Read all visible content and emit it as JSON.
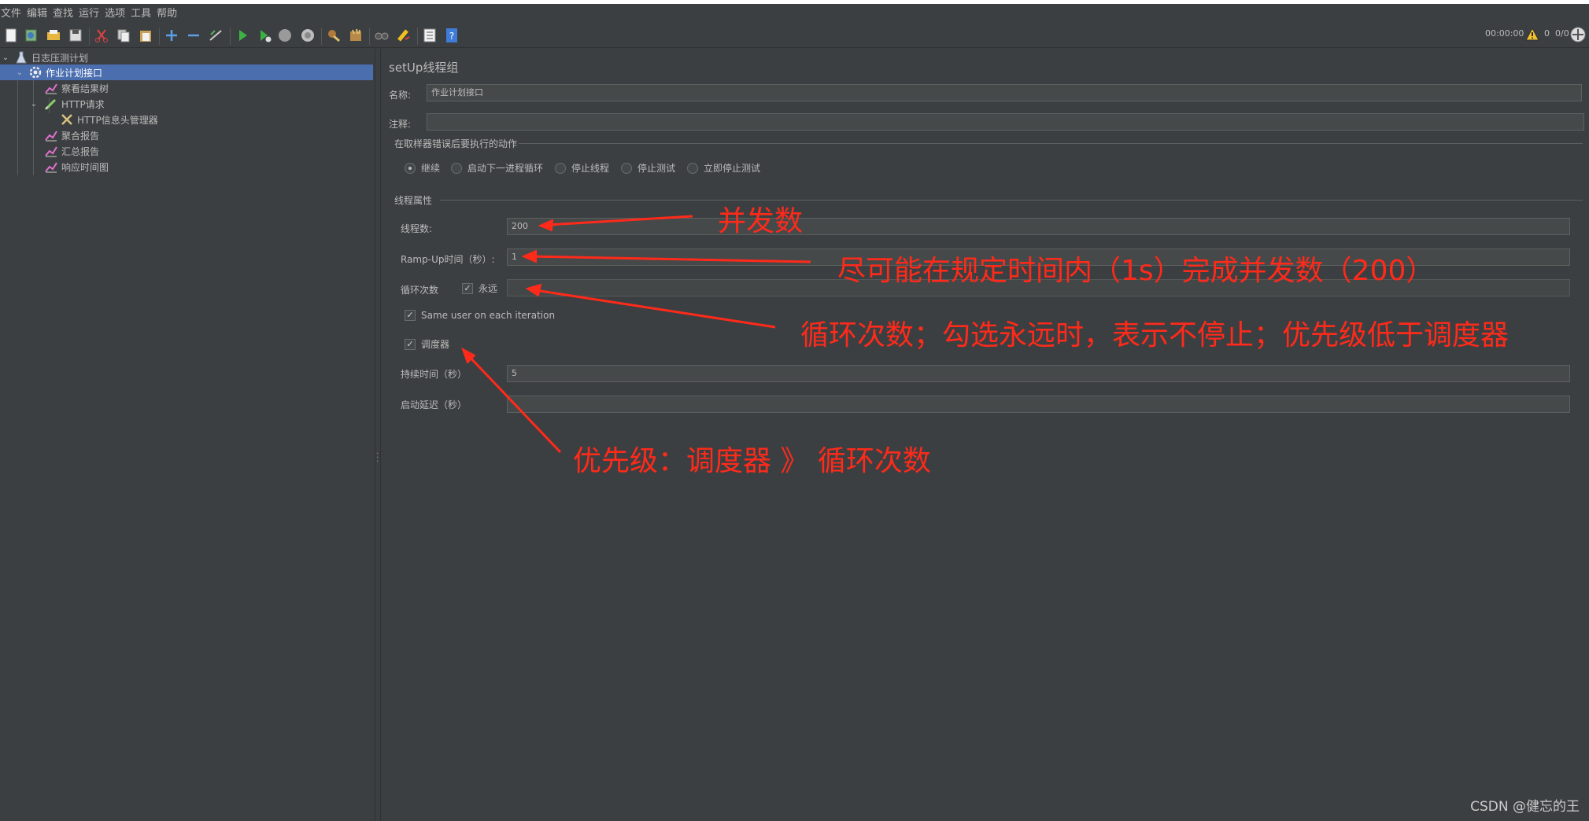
{
  "menu": [
    "文件",
    "编辑",
    "查找",
    "运行",
    "选项",
    "工具",
    "帮助"
  ],
  "toolbar": {
    "icons": [
      "new-icon",
      "templates-icon",
      "open-icon",
      "save-icon",
      "cut-icon",
      "copy-icon",
      "paste-icon",
      "expand-icon",
      "collapse-icon",
      "toggle-icon",
      "start-icon",
      "start-no-pause-icon",
      "stop-icon",
      "shutdown-icon",
      "clear-icon",
      "clear-all-icon",
      "search-icon",
      "reset-search-icon",
      "function-helper-icon",
      "help-icon"
    ],
    "timer": "00:00:00",
    "warnings": "0",
    "threads": "0/0"
  },
  "tree": [
    {
      "label": "日志压测计划",
      "icon": "test-plan-icon"
    },
    {
      "label": "作业计划接口",
      "icon": "gear-icon"
    },
    {
      "label": "察看结果树",
      "icon": "listener-chart-icon"
    },
    {
      "label": "HTTP请求",
      "icon": "sampler-pen-icon"
    },
    {
      "label": "HTTP信息头管理器",
      "icon": "config-tools-icon"
    },
    {
      "label": "聚合报告",
      "icon": "listener-chart-icon"
    },
    {
      "label": "汇总报告",
      "icon": "listener-chart-icon"
    },
    {
      "label": "响应时间图",
      "icon": "listener-chart-icon"
    }
  ],
  "panel": {
    "title": "setUp线程组",
    "name_label": "名称:",
    "name_value": "作业计划接口",
    "comment_label": "注释:",
    "comment_value": "",
    "error_action_title": "在取样器错误后要执行的动作",
    "error_actions": [
      {
        "label": "继续",
        "selected": true
      },
      {
        "label": "启动下一进程循环",
        "selected": false
      },
      {
        "label": "停止线程",
        "selected": false
      },
      {
        "label": "停止测试",
        "selected": false
      },
      {
        "label": "立即停止测试",
        "selected": false
      }
    ],
    "thread_props_title": "线程属性",
    "threads_label": "线程数:",
    "threads_value": "200",
    "rampup_label": "Ramp-Up时间（秒）:",
    "rampup_value": "1",
    "loop_label": "循环次数",
    "forever_label": "永远",
    "forever_checked": true,
    "loop_value": "",
    "same_user_label": "Same user on each iteration",
    "same_user_checked": true,
    "scheduler_label": "调度器",
    "scheduler_checked": true,
    "duration_label": "持续时间（秒）",
    "duration_value": "5",
    "delay_label": "启动延迟（秒）",
    "delay_value": ""
  },
  "annotations": {
    "concurrency": "并发数",
    "rampup": "尽可能在规定时间内（1s）完成并发数（200）",
    "loop": "循环次数；勾选永远时，表示不停止；优先级低于调度器",
    "priority": "优先级：调度器 》 循环次数"
  },
  "watermark": "CSDN @健忘的王",
  "colors": {
    "background": "#3c3f41",
    "selection": "#4b6eaf",
    "annotation": "#ff2a1a"
  }
}
